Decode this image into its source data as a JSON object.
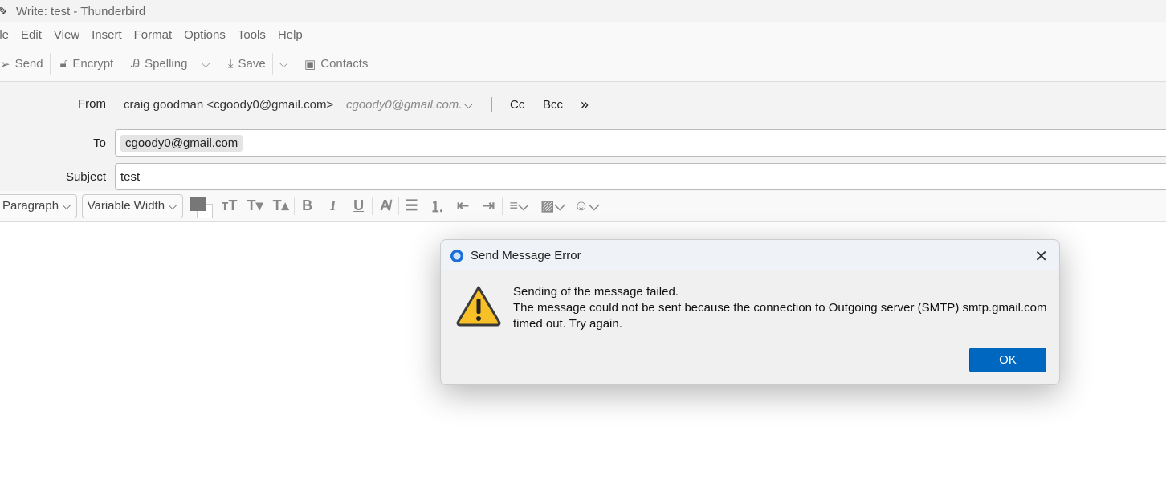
{
  "window": {
    "title": "Write: test - Thunderbird"
  },
  "menu": [
    "ile",
    "Edit",
    "View",
    "Insert",
    "Format",
    "Options",
    "Tools",
    "Help"
  ],
  "toolbar": {
    "send": "Send",
    "encrypt": "Encrypt",
    "spelling": "Spelling",
    "save": "Save",
    "contacts": "Contacts"
  },
  "headers": {
    "from_label": "From",
    "from_value": "craig goodman <cgoody0@gmail.com>",
    "from_identity": "cgoody0@gmail.com.",
    "cc": "Cc",
    "bcc": "Bcc",
    "to_label": "To",
    "to_recipient": "cgoody0@gmail.com",
    "subject_label": "Subject",
    "subject_value": "test"
  },
  "format": {
    "paragraph": "Paragraph",
    "font": "Variable Width"
  },
  "dialog": {
    "title": "Send Message Error",
    "line1": "Sending of the message failed.",
    "line2": "The message could not be sent because the connection to Outgoing server (SMTP) smtp.gmail.com",
    "line3": "timed out. Try again.",
    "ok": "OK"
  },
  "colors": {
    "accent": "#0067c0",
    "warning": "#f6c026"
  }
}
